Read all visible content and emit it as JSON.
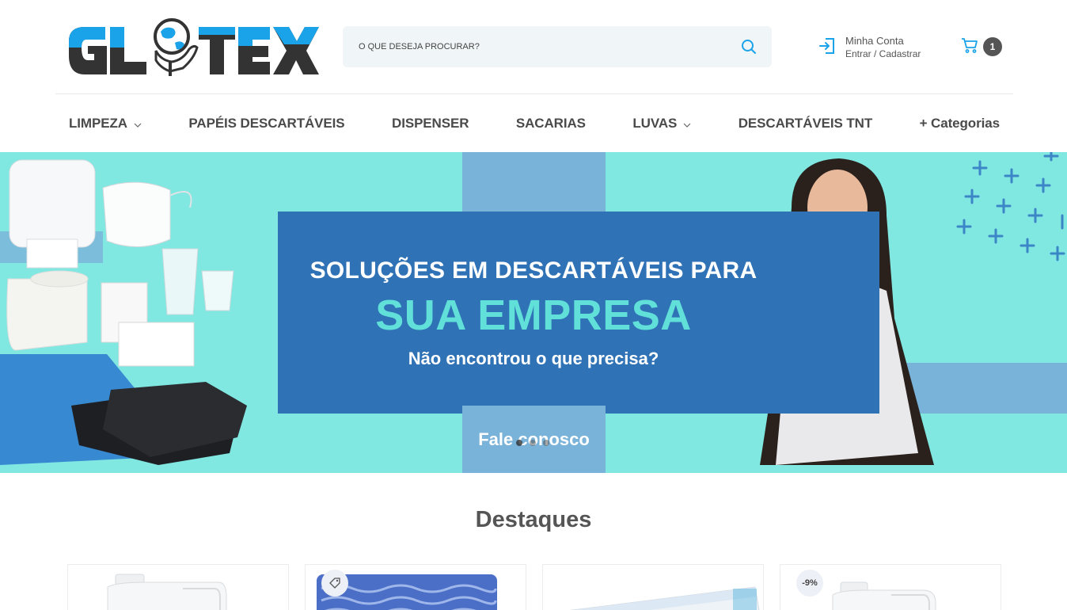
{
  "brand": {
    "name": "GLOTEX",
    "accent": "#1aa3e8",
    "dark": "#333333"
  },
  "search": {
    "placeholder": "O QUE DESEJA PROCURAR?",
    "icon": "search-icon"
  },
  "account": {
    "icon": "login-icon",
    "title": "Minha Conta",
    "links": "Entrar / Cadastrar"
  },
  "cart": {
    "icon": "cart-icon",
    "count": "1"
  },
  "nav": {
    "items": [
      {
        "label": "LIMPEZA",
        "has_dropdown": true
      },
      {
        "label": "PAPÉIS DESCARTÁVEIS",
        "has_dropdown": false
      },
      {
        "label": "DISPENSER",
        "has_dropdown": false
      },
      {
        "label": "SACARIAS",
        "has_dropdown": false
      },
      {
        "label": "LUVAS",
        "has_dropdown": true
      },
      {
        "label": "DESCARTÁVEIS TNT",
        "has_dropdown": false
      },
      {
        "label": "+ Categorias",
        "has_dropdown": false
      }
    ]
  },
  "banner": {
    "headline": "SOLUÇÕES EM DESCARTÁVEIS PARA",
    "highlight": "SUA EMPRESA",
    "subtitle": "Não encontrou o que precisa?",
    "cta": "Fale conosco",
    "slides_total": 3,
    "active_slide": 1,
    "colors": {
      "background": "#80e7e1",
      "panel": "#2f72b6",
      "highlight": "#60e0d8",
      "cta": "#7ab3d9"
    }
  },
  "featured": {
    "title": "Destaques",
    "products": [
      {
        "image": "gallon-jug",
        "badge": ""
      },
      {
        "image": "cloth-roll",
        "badge_icon": "tag-icon"
      },
      {
        "image": "product-box",
        "badge": ""
      },
      {
        "image": "gallon-jug",
        "badge": "-9%"
      }
    ]
  }
}
